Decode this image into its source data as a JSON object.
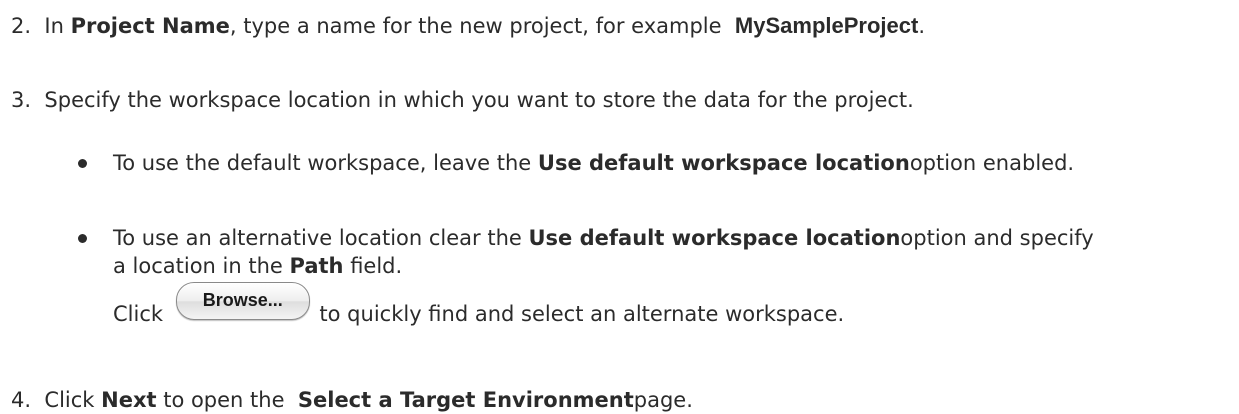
{
  "step2": {
    "number": "2.",
    "t1": "In ",
    "b1": "Project Name",
    "t2": ", type a name for the new project, for example ",
    "b2": "MySampleProject",
    "t3": "."
  },
  "step3": {
    "number": "3.",
    "text": "Specify the workspace location in which you want to store the data for the project."
  },
  "bullet1": {
    "t1": "To use the default workspace, leave the ",
    "b1": "Use default workspace location",
    "t2": "option enabled."
  },
  "bullet2": {
    "t1": "To use an alternative location clear the ",
    "b1": "Use default workspace location",
    "t2": "option and specify",
    "l2t1": "a location in the ",
    "l2b1": "Path",
    "l2t2": " field.",
    "l3t1": "Click ",
    "button_label": "Browse...",
    "l3t2": " to quickly find and select an alternate workspace."
  },
  "step4": {
    "number": "4.",
    "t1": "Click ",
    "b1": "Next",
    "t2": " to open the ",
    "b2": "Select a Target Environment",
    "t3": "page."
  }
}
